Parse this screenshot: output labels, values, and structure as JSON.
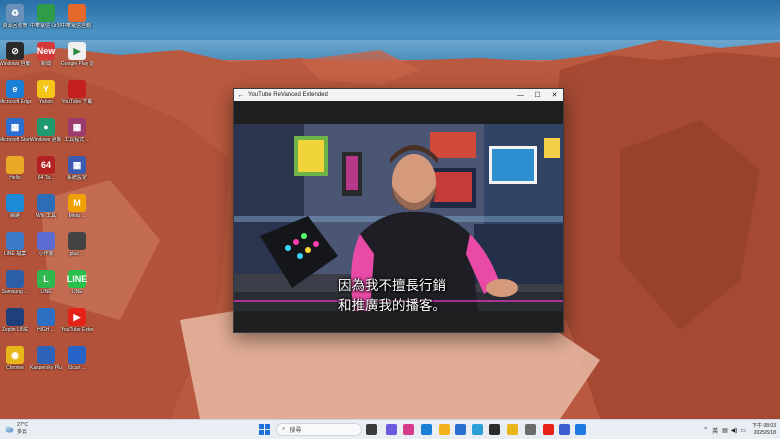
{
  "window": {
    "title": "YouTube ReVanced Extended",
    "back_glyph": "←",
    "minimize_glyph": "—",
    "maximize_glyph": "☐",
    "close_glyph": "✕"
  },
  "video": {
    "subtitle_line1": "因為我不擅長行銷",
    "subtitle_line2": "和推廣我的播客。"
  },
  "desktop_icons": [
    {
      "label": "資源回收筒",
      "color": "#6a8fb8",
      "glyph": "♻"
    },
    {
      "label": "中華電信 Ur365",
      "color": "#2e9c48",
      "glyph": ""
    },
    {
      "label": "中華電信自動 ...",
      "color": "#e36a2c",
      "glyph": ""
    },
    {
      "label": "Windows 自動 修復",
      "color": "#2a2a2a",
      "glyph": "⊘"
    },
    {
      "label": "新聞",
      "color": "#d43a3a",
      "glyph": "New"
    },
    {
      "label": "Google Play 遊戲",
      "color": "#f0f0f0",
      "glyph": "▶"
    },
    {
      "label": "Microsoft Edge",
      "color": "#1a7fd6",
      "glyph": "e"
    },
    {
      "label": "Yahoo",
      "color": "#f5c518",
      "glyph": "Y"
    },
    {
      "label": "YouTube 下載",
      "color": "#c42020",
      "glyph": ""
    },
    {
      "label": "Microsoft Store",
      "color": "#2b6fd1",
      "glyph": "▦"
    },
    {
      "label": "Windows 更新 ...",
      "color": "#1f9a6f",
      "glyph": "●"
    },
    {
      "label": "工具程式 ...",
      "color": "#9b3b6e",
      "glyph": "▦"
    },
    {
      "label": "Hello",
      "color": "#e8a924",
      "glyph": ""
    },
    {
      "label": "64 Ta...",
      "color": "#b22222",
      "glyph": "64"
    },
    {
      "label": "系統設定",
      "color": "#3a5bb0",
      "glyph": "▦"
    },
    {
      "label": "網路",
      "color": "#1c8ad8",
      "glyph": ""
    },
    {
      "label": "Win 工具",
      "color": "#2d6db5",
      "glyph": ""
    },
    {
      "label": "Meta ...",
      "color": "#f0a000",
      "glyph": "M"
    },
    {
      "label": "LINE 檔案",
      "color": "#3a7bc8",
      "glyph": ""
    },
    {
      "label": "小作家",
      "color": "#5b6bd1",
      "glyph": ""
    },
    {
      "label": "plus ...",
      "color": "#444",
      "glyph": ""
    },
    {
      "label": "Samsung ...",
      "color": "#2a5ea8",
      "glyph": ""
    },
    {
      "label": "LINE",
      "color": "#2fb84d",
      "glyph": "L"
    },
    {
      "label": "LINE",
      "color": "#26c04a",
      "glyph": "LINE"
    },
    {
      "label": "Zeplin LINE",
      "color": "#1f3f7a",
      "glyph": ""
    },
    {
      "label": "HiGH ...",
      "color": "#2b70c2",
      "glyph": ""
    },
    {
      "label": "YouTube Extended",
      "color": "#e62117",
      "glyph": "▶"
    },
    {
      "label": "Chrome",
      "color": "#e9b619",
      "glyph": "◉"
    },
    {
      "label": "Kaspersky Plus ...",
      "color": "#2d63b8",
      "glyph": ""
    },
    {
      "label": "iScan ...",
      "color": "#2563c9",
      "glyph": ""
    }
  ],
  "taskbar": {
    "weather_temp": "27°C",
    "weather_desc": "多云",
    "search_placeholder": "搜尋",
    "ime": "英",
    "time": "下午 08:03",
    "date": "2025/5/18",
    "icons": [
      {
        "name": "start-button",
        "color": "#1e6fd9"
      },
      {
        "name": "task-view",
        "color": "#3b3b3b"
      },
      {
        "name": "copilot",
        "color": "#6a5ae0"
      },
      {
        "name": "widgets",
        "color": "#d63a8a"
      },
      {
        "name": "edge",
        "color": "#1a7fd6"
      },
      {
        "name": "file-explorer",
        "color": "#f2b21c"
      },
      {
        "name": "store",
        "color": "#2b6fd1"
      },
      {
        "name": "photos",
        "color": "#2a9fd8"
      },
      {
        "name": "terminal",
        "color": "#2b2b2b"
      },
      {
        "name": "chrome",
        "color": "#e9b619"
      },
      {
        "name": "settings",
        "color": "#6b6b6b"
      },
      {
        "name": "youtube",
        "color": "#e62117"
      },
      {
        "name": "app",
        "color": "#3c5fd0"
      },
      {
        "name": "bluetooth",
        "color": "#1f7ae0"
      }
    ]
  }
}
